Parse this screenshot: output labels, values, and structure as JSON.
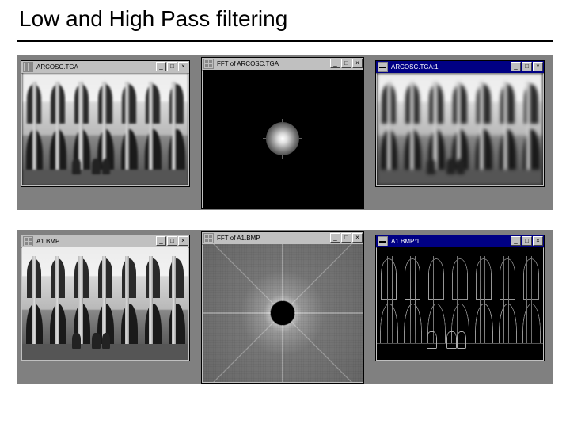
{
  "title": "Low and High Pass filtering",
  "rows": [
    {
      "windows": [
        {
          "sys": "grid",
          "title": "ARCOSC.TGA",
          "title_style": "gray",
          "content": "arches-blur"
        },
        {
          "sys": "grid",
          "title": "FFT of ARCOSC.TGA",
          "title_style": "gray",
          "content": "fft-low"
        },
        {
          "sys": "dash",
          "title": "ARCOSC.TGA:1",
          "title_style": "blue",
          "content": "arches-blur"
        }
      ]
    },
    {
      "windows": [
        {
          "sys": "grid",
          "title": "A1.BMP",
          "title_style": "gray",
          "content": "arches"
        },
        {
          "sys": "grid",
          "title": "FFT of A1.BMP",
          "title_style": "gray",
          "content": "fft-high"
        },
        {
          "sys": "dash",
          "title": "A1.BMP:1",
          "title_style": "blue",
          "content": "edges"
        }
      ]
    }
  ],
  "buttons": {
    "min": "_",
    "max": "□",
    "close": "×"
  }
}
